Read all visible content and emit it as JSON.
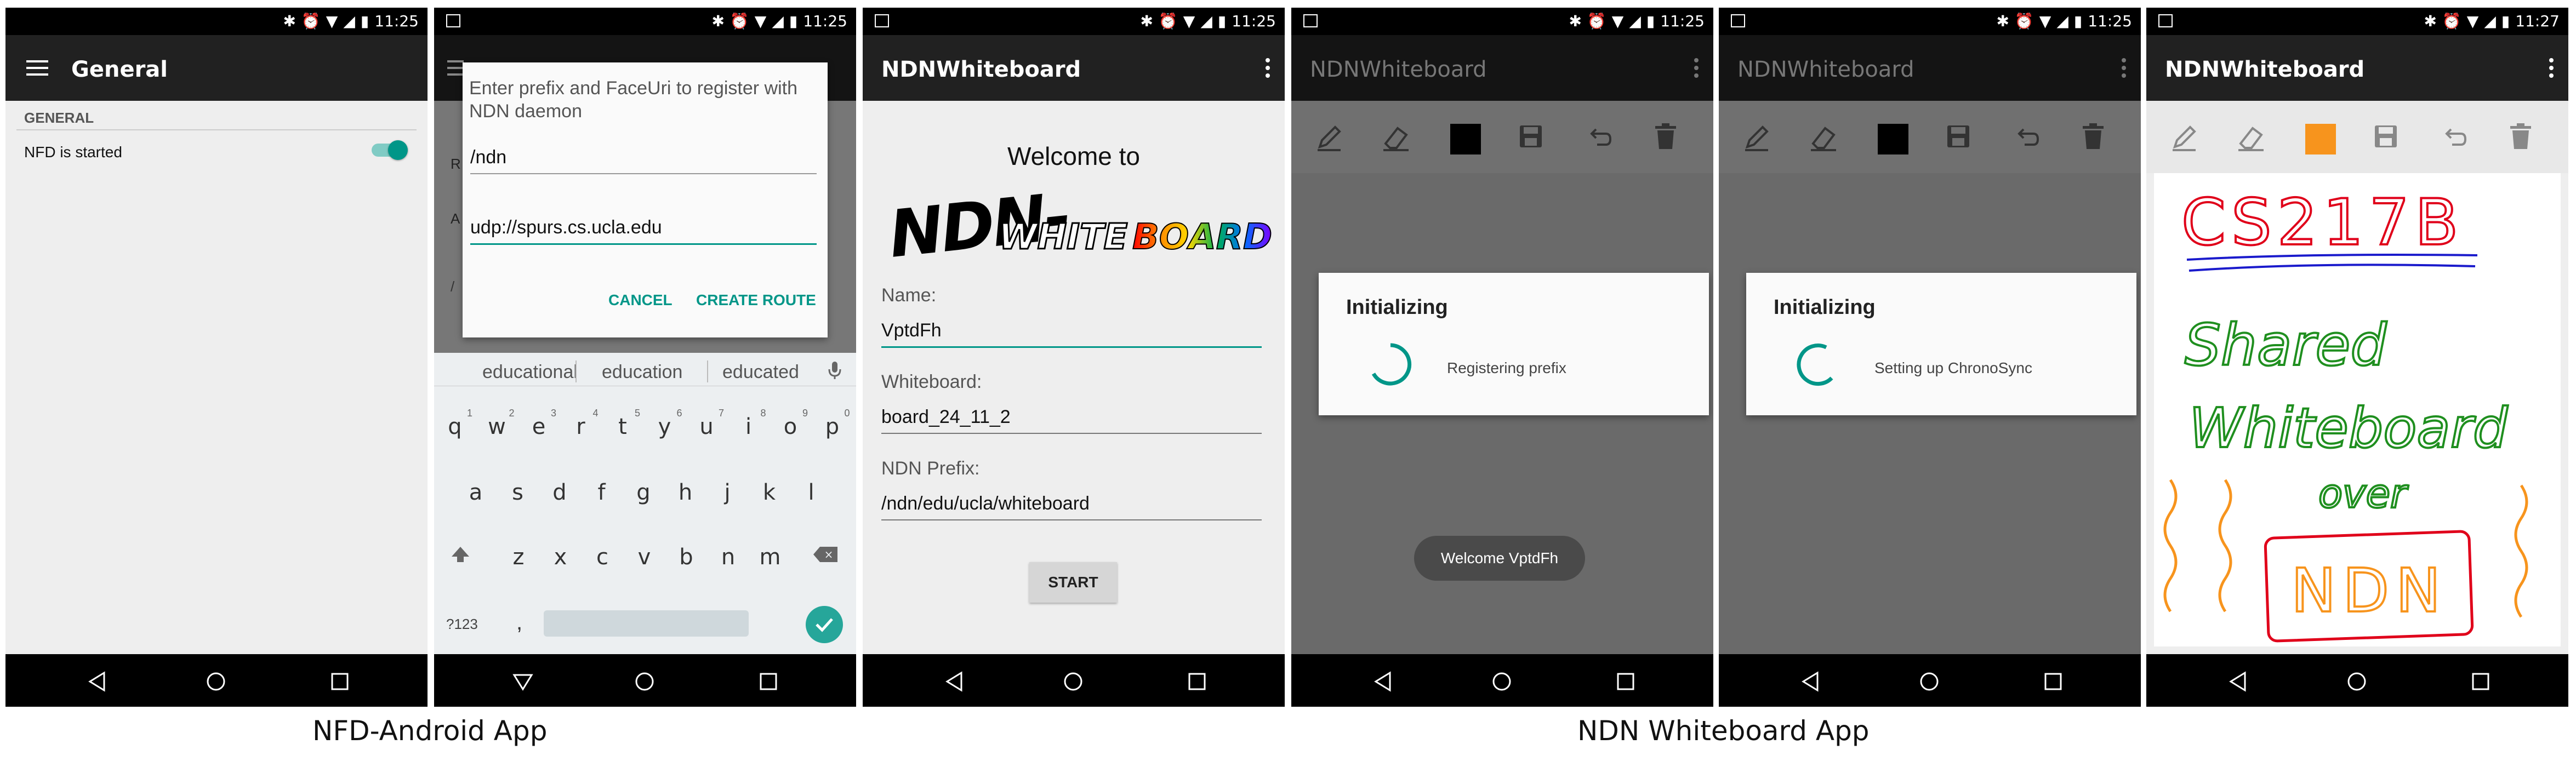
{
  "status": {
    "time": [
      "11:25",
      "11:25",
      "11:25",
      "11:25",
      "11:25",
      "11:27"
    ],
    "icons": [
      "image-icon",
      "bluetooth-icon",
      "alarm-icon",
      "wifi-icon",
      "signal-icon",
      "battery-icon"
    ]
  },
  "screen1": {
    "title": "General",
    "section": "GENERAL",
    "nfd_label": "NFD is started",
    "nfd_on": true
  },
  "screen2": {
    "partial_labels": [
      "R",
      "A",
      "/"
    ],
    "dialog_text": "Enter prefix and FaceUri to register with NDN daemon",
    "prefix_value": "/ndn",
    "faceuri_value": "udp://spurs.cs.ucla.edu",
    "cancel_label": "CANCEL",
    "create_label": "CREATE ROUTE",
    "suggestions": [
      "educational",
      "education",
      "educated"
    ],
    "row1": [
      "q",
      "w",
      "e",
      "r",
      "t",
      "y",
      "u",
      "i",
      "o",
      "p"
    ],
    "row1_nums": [
      "1",
      "2",
      "3",
      "4",
      "5",
      "6",
      "7",
      "8",
      "9",
      "0"
    ],
    "row2": [
      "a",
      "s",
      "d",
      "f",
      "g",
      "h",
      "j",
      "k",
      "l"
    ],
    "row3": [
      "z",
      "x",
      "c",
      "v",
      "b",
      "n",
      "m"
    ],
    "sym_label": "?123",
    "comma": ","
  },
  "screen3": {
    "title": "NDNWhiteboard",
    "welcome": "Welcome to",
    "logo_ndn": "NDN-",
    "logo_white": "WHITE",
    "logo_board": "BOARD",
    "name_label": "Name:",
    "name_value": "VptdFh",
    "wb_label": "Whiteboard:",
    "wb_value": "board_24_11_2",
    "prefix_label": "NDN Prefix:",
    "prefix_value": "/ndn/edu/ucla/whiteboard",
    "start_label": "START"
  },
  "screen4": {
    "title": "NDNWhiteboard",
    "dialog_title": "Initializing",
    "dialog_msg": "Registering prefix",
    "toast": "Welcome VptdFh"
  },
  "screen5": {
    "title": "NDNWhiteboard",
    "dialog_title": "Initializing",
    "dialog_msg": "Setting up ChronoSync"
  },
  "screen6": {
    "title": "NDNWhiteboard",
    "drawing_text": [
      "CS217B",
      "Shared",
      "Whiteboard",
      "over",
      "NDN"
    ],
    "selected_color": "#f7941d"
  },
  "captions": {
    "left": "NFD-Android App",
    "right": "NDN Whiteboard App"
  },
  "colors": {
    "accent": "#009688",
    "appbar": "#212121",
    "black_swatch": "#000000"
  }
}
